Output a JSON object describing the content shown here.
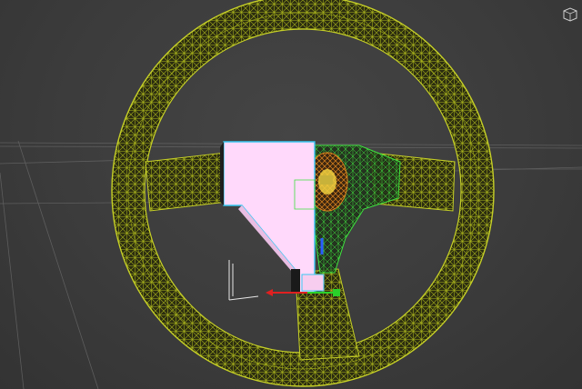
{
  "viewport": {
    "view": "perspective",
    "shading": "wireframe",
    "grid": true,
    "background_color": "#3c3c3c"
  },
  "scene": {
    "object": "steering wheel",
    "wireframe_color": "#b8c41e",
    "selected_face_color": "#ffd9fb",
    "selection_edge_color": "#39c8f2",
    "hub_color": "#d87a1a",
    "hub_wire_color": "#3ee03e"
  },
  "gizmo": {
    "x_axis_color": "#e02020",
    "y_axis_color": "#2ad12a",
    "z_axis_color": "#2a5cff"
  },
  "icons": {
    "axis_tripod": "axis-tripod-icon",
    "viewcube": "viewcube-icon"
  }
}
